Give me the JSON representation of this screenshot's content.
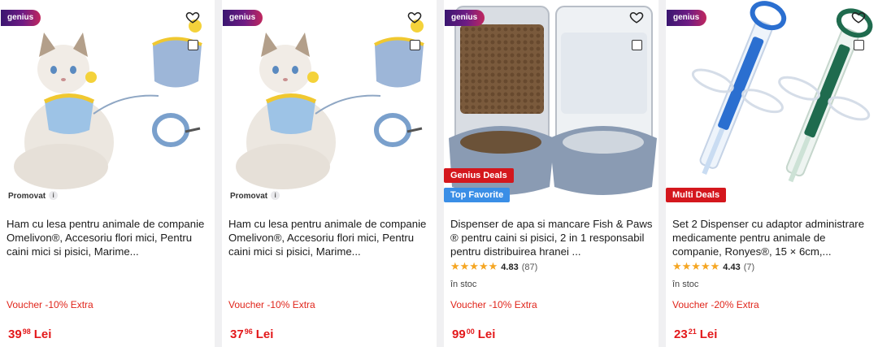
{
  "products": [
    {
      "genius": "genius",
      "promoted": "Promovat",
      "info": "i",
      "title": "Ham cu lesa pentru animale de companie Omelivon®, Accesoriu flori mici, Pentru caini mici si pisici, Marime...",
      "voucher": "Voucher -10% Extra",
      "price_int": "39",
      "price_dec": "98",
      "currency": "Lei"
    },
    {
      "genius": "genius",
      "promoted": "Promovat",
      "info": "i",
      "title": "Ham cu lesa pentru animale de companie Omelivon®, Accesoriu flori mici, Pentru caini mici si pisici, Marime...",
      "voucher": "Voucher -10% Extra",
      "price_int": "37",
      "price_dec": "96",
      "currency": "Lei"
    },
    {
      "genius": "genius",
      "badges": [
        "Genius Deals",
        "Top Favorite"
      ],
      "title": "Dispenser de apa si mancare Fish & Paws ® pentru caini si pisici, 2 in 1 responsabil pentru distribuirea hranei ...",
      "rating_score": "4.83",
      "rating_count": "(87)",
      "stars": "★★★★★",
      "stock": "în stoc",
      "voucher": "Voucher -10% Extra",
      "price_int": "99",
      "price_dec": "00",
      "currency": "Lei"
    },
    {
      "genius": "genius",
      "badges": [
        "Multi Deals"
      ],
      "title": "Set 2 Dispenser cu adaptor administrare medicamente pentru animale de companie, Ronyes®, 15 × 6cm,...",
      "rating_score": "4.43",
      "rating_count": "(7)",
      "stars": "★★★★★",
      "stock": "în stoc",
      "voucher": "Voucher -20% Extra",
      "price_int": "23",
      "price_dec": "21",
      "currency": "Lei"
    }
  ],
  "colors": {
    "price": "#e3191b",
    "voucher": "#e0251b",
    "star": "#f5a623",
    "badge_red": "#d4171d",
    "badge_blue": "#3a8ee6"
  },
  "icons": [
    "heart-icon",
    "compare-checkbox",
    "info-icon",
    "star-icon"
  ]
}
